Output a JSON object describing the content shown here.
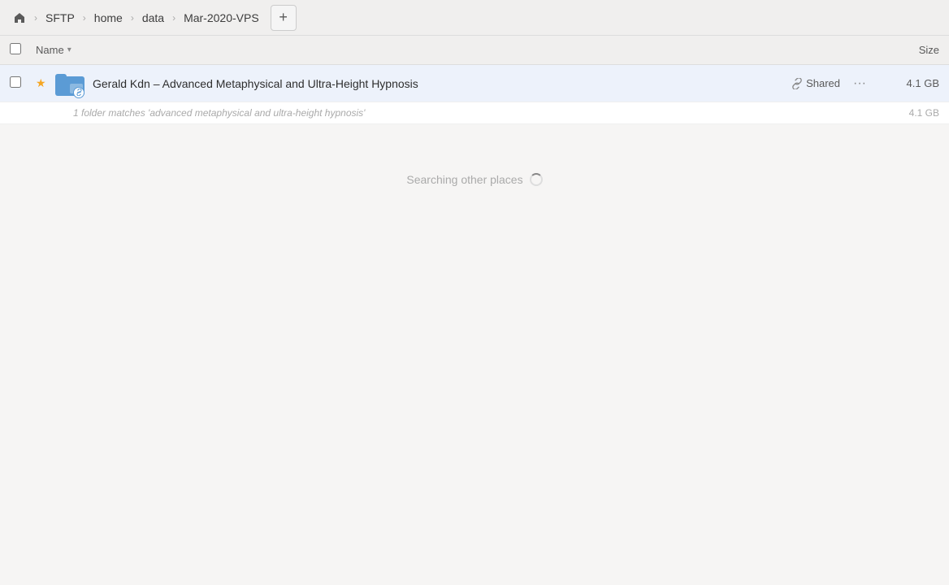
{
  "toolbar": {
    "home_icon": "🏠",
    "breadcrumbs": [
      {
        "label": "SFTP",
        "id": "sftp"
      },
      {
        "label": "home",
        "id": "home"
      },
      {
        "label": "data",
        "id": "data"
      },
      {
        "label": "Mar-2020-VPS",
        "id": "mar-2020-vps"
      }
    ],
    "add_button_label": "+"
  },
  "columns": {
    "checkbox_label": "",
    "name_label": "Name",
    "name_sort_icon": "▾",
    "size_label": "Size"
  },
  "files": [
    {
      "id": "file-1",
      "starred": true,
      "name": "Gerald Kdn – Advanced Metaphysical and Ultra-Height Hypnosis",
      "shared": true,
      "shared_label": "Shared",
      "size": "4.1 GB",
      "match_text": "1 folder matches 'advanced metaphysical and ultra-height hypnosis'",
      "match_size": "4.1 GB"
    }
  ],
  "searching": {
    "label": "Searching other places"
  }
}
